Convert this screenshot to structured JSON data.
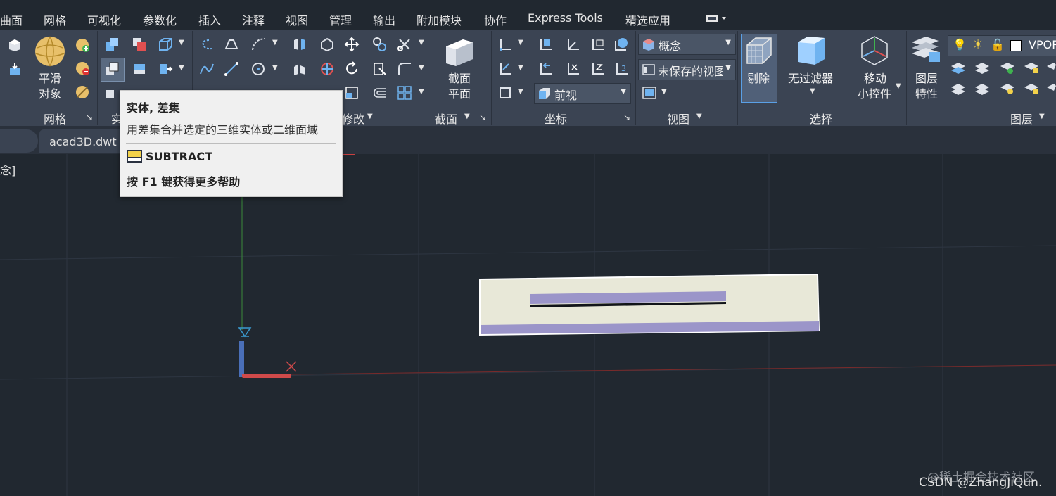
{
  "menubar": {
    "items": [
      "曲面",
      "网格",
      "可视化",
      "参数化",
      "插入",
      "注释",
      "视图",
      "管理",
      "输出",
      "附加模块",
      "协作",
      "Express Tools",
      "精选应用"
    ]
  },
  "ribbon": {
    "mesh_panel": {
      "smooth_label_1": "平滑",
      "smooth_label_2": "对象",
      "panel_label": "网格"
    },
    "solid_panel": {
      "panel_label": "实"
    },
    "modify_panel": {
      "panel_label": "修改"
    },
    "section_panel": {
      "label_1": "截面",
      "label_2": "平面",
      "panel_label": "截面"
    },
    "coords_panel": {
      "view_dropdown": "前视",
      "panel_label": "坐标"
    },
    "view_panel": {
      "visual_style": "概念",
      "saved_view": "未保存的视图",
      "panel_label": "视图"
    },
    "select_panel": {
      "cull_label": "剔除",
      "filter_label": "无过滤器",
      "gizmo_label_1": "移动",
      "gizmo_label_2": "小控件",
      "panel_label": "选择"
    },
    "layers_panel": {
      "props_label_1": "图层",
      "props_label_2": "特性",
      "vport_label": "VPOR",
      "panel_label": "图层"
    }
  },
  "tabs": {
    "file_tab": "acad3D.dwt"
  },
  "viewport": {
    "label": "念]"
  },
  "tooltip": {
    "title": "实体, 差集",
    "description": "用差集合并选定的三维实体或二维面域",
    "command": "SUBTRACT",
    "help": "按 F1 键获得更多帮助"
  },
  "watermark": {
    "line1": "@稀土掘金技术社区",
    "line2": "CSDN @ZhangJiQun."
  },
  "colors": {
    "background": "#212830",
    "ribbon": "#3b4453",
    "accent": "#5aa0e6",
    "shape_fill": "#e8e8d8",
    "shape_slot": "#9b95c9"
  }
}
